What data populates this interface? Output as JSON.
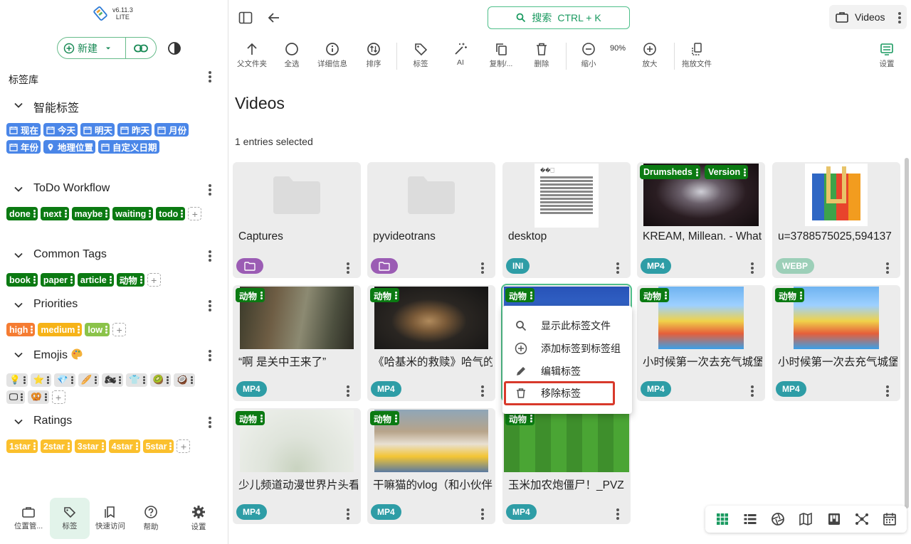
{
  "app": {
    "version": "v6.11.3",
    "edition": "LITE"
  },
  "sidebar": {
    "new_label": "新建",
    "library_title": "标签库",
    "groups": [
      {
        "name": "智能标签",
        "tags": [
          "现在",
          "今天",
          "明天",
          "昨天",
          "月份",
          "年份",
          "地理位置",
          "自定义日期"
        ]
      },
      {
        "name": "ToDo Workflow",
        "tags": [
          "done",
          "next",
          "maybe",
          "waiting",
          "todo"
        ]
      },
      {
        "name": "Common Tags",
        "tags": [
          "book",
          "paper",
          "article",
          "动物"
        ]
      },
      {
        "name": "Priorities",
        "tags": [
          "high",
          "medium",
          "low"
        ]
      },
      {
        "name": "Emojis",
        "tags": [
          "💡",
          "⭐",
          "💎",
          "🥖",
          "🏍",
          "👕",
          "🥝",
          "🥥",
          "🖵",
          "🥨"
        ]
      },
      {
        "name": "Ratings",
        "tags": [
          "1star",
          "2star",
          "3star",
          "4star",
          "5star"
        ]
      }
    ],
    "bottom_nav": [
      {
        "label": "位置管..."
      },
      {
        "label": "标签"
      },
      {
        "label": "快速访问"
      },
      {
        "label": "帮助"
      },
      {
        "label": "设置"
      }
    ]
  },
  "header": {
    "search_label": "搜索",
    "search_shortcut": "CTRL + K",
    "location": "Videos"
  },
  "toolbar": {
    "items": [
      "父文件夹",
      "全选",
      "详细信息",
      "排序",
      "标签",
      "AI",
      "复制/...",
      "删除",
      "缩小",
      "放大",
      "拖放文件"
    ],
    "zoom": "90%",
    "settings": "设置"
  },
  "page": {
    "title": "Videos",
    "selection_info": "1 entries selected"
  },
  "entries": [
    {
      "name": "Captures",
      "type": "folder",
      "tags": []
    },
    {
      "name": "pyvideotrans",
      "type": "folder",
      "tags": []
    },
    {
      "name": "desktop",
      "type": "INI",
      "tags": []
    },
    {
      "name": "KREAM, Millean. - What",
      "type": "MP4",
      "tags": [
        "Drumsheds",
        "Version"
      ]
    },
    {
      "name": "u=3788575025,594137",
      "type": "WEBP",
      "tags": []
    },
    {
      "name": "“啊 是关中王来了”",
      "type": "MP4",
      "tags": [
        "动物"
      ]
    },
    {
      "name": "《哈基米的救赎》哈气的",
      "type": "MP4",
      "tags": [
        "动物"
      ]
    },
    {
      "name": "",
      "type": "",
      "tags": [
        "动物"
      ]
    },
    {
      "name": "小时候第一次去充气城堡",
      "type": "MP4",
      "tags": [
        "动物"
      ]
    },
    {
      "name": "小时候第一次去充气城堡",
      "type": "MP4",
      "tags": [
        "动物"
      ]
    },
    {
      "name": "少儿频道动漫世界片头看",
      "type": "MP4",
      "tags": [
        "动物"
      ]
    },
    {
      "name": "干嘛猫的vlog（和小伙伴",
      "type": "MP4",
      "tags": [
        "动物"
      ]
    },
    {
      "name": "玉米加农炮僵尸！_PVZ",
      "type": "MP4",
      "tags": [
        "动物"
      ]
    }
  ],
  "context_menu": {
    "items": [
      "显示此标签文件",
      "添加标签到标签组",
      "编辑标签",
      "移除标签"
    ]
  },
  "thumb_text": {
    "desktop": "��🗌"
  },
  "colors": {
    "accent": "#1a9a60",
    "smart_tag": "#4a86e8",
    "todo_tag": "#0b7a12",
    "highlight": "#d8392b"
  }
}
